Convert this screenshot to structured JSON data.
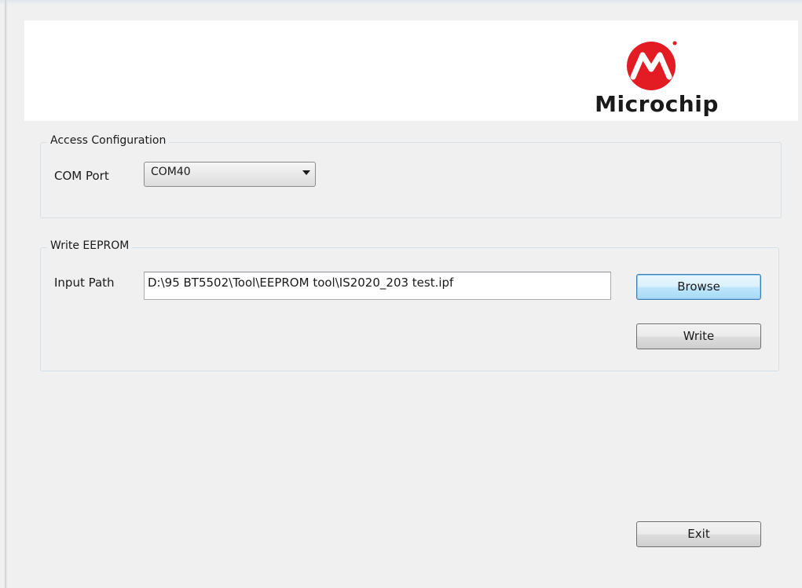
{
  "brand": {
    "logo_text": "Microchip",
    "logo_color": "#e31b23"
  },
  "access_configuration": {
    "legend": "Access Configuration",
    "com_port_label": "COM Port",
    "com_port_value": "COM40"
  },
  "write_eeprom": {
    "legend": "Write EEPROM",
    "input_path_label": "Input Path",
    "input_path_value": "D:\\95 BT5502\\Tool\\EEPROM tool\\IS2020_203 test.ipf",
    "browse_label": "Browse",
    "write_label": "Write"
  },
  "footer": {
    "exit_label": "Exit"
  }
}
